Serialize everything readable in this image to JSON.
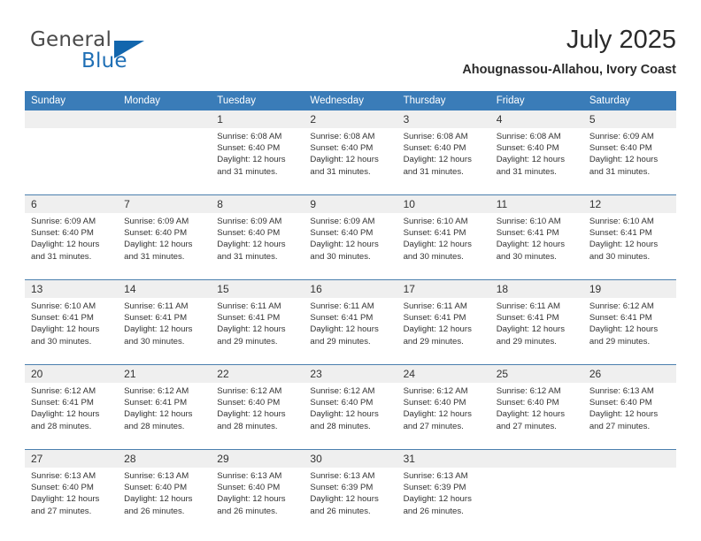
{
  "brand": {
    "name_part1": "General",
    "name_part2": "Blue",
    "triangle_icon": "triangle-icon"
  },
  "header": {
    "title": "July 2025",
    "location": "Ahougnassou-Allahou, Ivory Coast"
  },
  "theme": {
    "header_blue": "#3a7cb8",
    "daynum_gray": "#efefef",
    "separator_blue": "#4a7fae",
    "logo_blue": "#1f6fb5",
    "text": "#333333"
  },
  "calendar": {
    "weekday_headers": [
      "Sunday",
      "Monday",
      "Tuesday",
      "Wednesday",
      "Thursday",
      "Friday",
      "Saturday"
    ],
    "weeks": [
      [
        {
          "day": "",
          "sunrise": "",
          "sunset": "",
          "daylight_line1": "",
          "daylight_line2": ""
        },
        {
          "day": "",
          "sunrise": "",
          "sunset": "",
          "daylight_line1": "",
          "daylight_line2": ""
        },
        {
          "day": "1",
          "sunrise": "Sunrise: 6:08 AM",
          "sunset": "Sunset: 6:40 PM",
          "daylight_line1": "Daylight: 12 hours",
          "daylight_line2": "and 31 minutes."
        },
        {
          "day": "2",
          "sunrise": "Sunrise: 6:08 AM",
          "sunset": "Sunset: 6:40 PM",
          "daylight_line1": "Daylight: 12 hours",
          "daylight_line2": "and 31 minutes."
        },
        {
          "day": "3",
          "sunrise": "Sunrise: 6:08 AM",
          "sunset": "Sunset: 6:40 PM",
          "daylight_line1": "Daylight: 12 hours",
          "daylight_line2": "and 31 minutes."
        },
        {
          "day": "4",
          "sunrise": "Sunrise: 6:08 AM",
          "sunset": "Sunset: 6:40 PM",
          "daylight_line1": "Daylight: 12 hours",
          "daylight_line2": "and 31 minutes."
        },
        {
          "day": "5",
          "sunrise": "Sunrise: 6:09 AM",
          "sunset": "Sunset: 6:40 PM",
          "daylight_line1": "Daylight: 12 hours",
          "daylight_line2": "and 31 minutes."
        }
      ],
      [
        {
          "day": "6",
          "sunrise": "Sunrise: 6:09 AM",
          "sunset": "Sunset: 6:40 PM",
          "daylight_line1": "Daylight: 12 hours",
          "daylight_line2": "and 31 minutes."
        },
        {
          "day": "7",
          "sunrise": "Sunrise: 6:09 AM",
          "sunset": "Sunset: 6:40 PM",
          "daylight_line1": "Daylight: 12 hours",
          "daylight_line2": "and 31 minutes."
        },
        {
          "day": "8",
          "sunrise": "Sunrise: 6:09 AM",
          "sunset": "Sunset: 6:40 PM",
          "daylight_line1": "Daylight: 12 hours",
          "daylight_line2": "and 31 minutes."
        },
        {
          "day": "9",
          "sunrise": "Sunrise: 6:09 AM",
          "sunset": "Sunset: 6:40 PM",
          "daylight_line1": "Daylight: 12 hours",
          "daylight_line2": "and 30 minutes."
        },
        {
          "day": "10",
          "sunrise": "Sunrise: 6:10 AM",
          "sunset": "Sunset: 6:41 PM",
          "daylight_line1": "Daylight: 12 hours",
          "daylight_line2": "and 30 minutes."
        },
        {
          "day": "11",
          "sunrise": "Sunrise: 6:10 AM",
          "sunset": "Sunset: 6:41 PM",
          "daylight_line1": "Daylight: 12 hours",
          "daylight_line2": "and 30 minutes."
        },
        {
          "day": "12",
          "sunrise": "Sunrise: 6:10 AM",
          "sunset": "Sunset: 6:41 PM",
          "daylight_line1": "Daylight: 12 hours",
          "daylight_line2": "and 30 minutes."
        }
      ],
      [
        {
          "day": "13",
          "sunrise": "Sunrise: 6:10 AM",
          "sunset": "Sunset: 6:41 PM",
          "daylight_line1": "Daylight: 12 hours",
          "daylight_line2": "and 30 minutes."
        },
        {
          "day": "14",
          "sunrise": "Sunrise: 6:11 AM",
          "sunset": "Sunset: 6:41 PM",
          "daylight_line1": "Daylight: 12 hours",
          "daylight_line2": "and 30 minutes."
        },
        {
          "day": "15",
          "sunrise": "Sunrise: 6:11 AM",
          "sunset": "Sunset: 6:41 PM",
          "daylight_line1": "Daylight: 12 hours",
          "daylight_line2": "and 29 minutes."
        },
        {
          "day": "16",
          "sunrise": "Sunrise: 6:11 AM",
          "sunset": "Sunset: 6:41 PM",
          "daylight_line1": "Daylight: 12 hours",
          "daylight_line2": "and 29 minutes."
        },
        {
          "day": "17",
          "sunrise": "Sunrise: 6:11 AM",
          "sunset": "Sunset: 6:41 PM",
          "daylight_line1": "Daylight: 12 hours",
          "daylight_line2": "and 29 minutes."
        },
        {
          "day": "18",
          "sunrise": "Sunrise: 6:11 AM",
          "sunset": "Sunset: 6:41 PM",
          "daylight_line1": "Daylight: 12 hours",
          "daylight_line2": "and 29 minutes."
        },
        {
          "day": "19",
          "sunrise": "Sunrise: 6:12 AM",
          "sunset": "Sunset: 6:41 PM",
          "daylight_line1": "Daylight: 12 hours",
          "daylight_line2": "and 29 minutes."
        }
      ],
      [
        {
          "day": "20",
          "sunrise": "Sunrise: 6:12 AM",
          "sunset": "Sunset: 6:41 PM",
          "daylight_line1": "Daylight: 12 hours",
          "daylight_line2": "and 28 minutes."
        },
        {
          "day": "21",
          "sunrise": "Sunrise: 6:12 AM",
          "sunset": "Sunset: 6:41 PM",
          "daylight_line1": "Daylight: 12 hours",
          "daylight_line2": "and 28 minutes."
        },
        {
          "day": "22",
          "sunrise": "Sunrise: 6:12 AM",
          "sunset": "Sunset: 6:40 PM",
          "daylight_line1": "Daylight: 12 hours",
          "daylight_line2": "and 28 minutes."
        },
        {
          "day": "23",
          "sunrise": "Sunrise: 6:12 AM",
          "sunset": "Sunset: 6:40 PM",
          "daylight_line1": "Daylight: 12 hours",
          "daylight_line2": "and 28 minutes."
        },
        {
          "day": "24",
          "sunrise": "Sunrise: 6:12 AM",
          "sunset": "Sunset: 6:40 PM",
          "daylight_line1": "Daylight: 12 hours",
          "daylight_line2": "and 27 minutes."
        },
        {
          "day": "25",
          "sunrise": "Sunrise: 6:12 AM",
          "sunset": "Sunset: 6:40 PM",
          "daylight_line1": "Daylight: 12 hours",
          "daylight_line2": "and 27 minutes."
        },
        {
          "day": "26",
          "sunrise": "Sunrise: 6:13 AM",
          "sunset": "Sunset: 6:40 PM",
          "daylight_line1": "Daylight: 12 hours",
          "daylight_line2": "and 27 minutes."
        }
      ],
      [
        {
          "day": "27",
          "sunrise": "Sunrise: 6:13 AM",
          "sunset": "Sunset: 6:40 PM",
          "daylight_line1": "Daylight: 12 hours",
          "daylight_line2": "and 27 minutes."
        },
        {
          "day": "28",
          "sunrise": "Sunrise: 6:13 AM",
          "sunset": "Sunset: 6:40 PM",
          "daylight_line1": "Daylight: 12 hours",
          "daylight_line2": "and 26 minutes."
        },
        {
          "day": "29",
          "sunrise": "Sunrise: 6:13 AM",
          "sunset": "Sunset: 6:40 PM",
          "daylight_line1": "Daylight: 12 hours",
          "daylight_line2": "and 26 minutes."
        },
        {
          "day": "30",
          "sunrise": "Sunrise: 6:13 AM",
          "sunset": "Sunset: 6:39 PM",
          "daylight_line1": "Daylight: 12 hours",
          "daylight_line2": "and 26 minutes."
        },
        {
          "day": "31",
          "sunrise": "Sunrise: 6:13 AM",
          "sunset": "Sunset: 6:39 PM",
          "daylight_line1": "Daylight: 12 hours",
          "daylight_line2": "and 26 minutes."
        },
        {
          "day": "",
          "sunrise": "",
          "sunset": "",
          "daylight_line1": "",
          "daylight_line2": ""
        },
        {
          "day": "",
          "sunrise": "",
          "sunset": "",
          "daylight_line1": "",
          "daylight_line2": ""
        }
      ]
    ]
  }
}
